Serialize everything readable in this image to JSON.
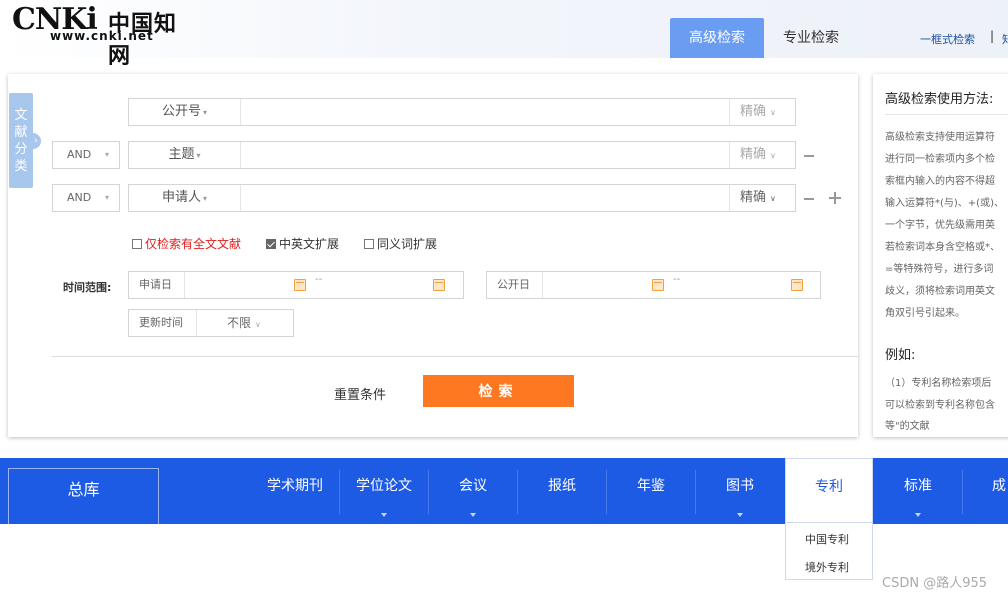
{
  "logo": {
    "mark": "CNKi",
    "name": "中国知网",
    "url": "www.cnki.net"
  },
  "header": {
    "tabs": [
      {
        "label": "高级检索"
      },
      {
        "label": "专业检索"
      }
    ],
    "links": [
      "一框式检索",
      "|",
      "知"
    ]
  },
  "sidetab": {
    "label": "文献分类",
    "chars": [
      "文",
      "献",
      "分",
      "类"
    ]
  },
  "search_rows": [
    {
      "logic": "",
      "field": "公开号",
      "precision": "精确"
    },
    {
      "logic": "AND",
      "field": "主题",
      "precision": "精确"
    },
    {
      "logic": "AND",
      "field": "申请人",
      "precision": "精确"
    }
  ],
  "options": [
    {
      "label": "仅检索有全文文献",
      "checked": false
    },
    {
      "label": "中英文扩展",
      "checked": true
    },
    {
      "label": "同义词扩展",
      "checked": false
    }
  ],
  "time": {
    "label": "时间范围:",
    "apply_date": "申请日",
    "pub_date": "公开日",
    "range_sep": "--",
    "update_label": "更新时间",
    "update_value": "不限"
  },
  "actions": {
    "reset": "重置条件",
    "search": "检索"
  },
  "help": {
    "title": "高级检索使用方法:",
    "lines": [
      "高级检索支持使用运算符",
      "进行同一检索项内多个检",
      "索框内输入的内容不得超",
      "输入运算符*(与)、+(或)、",
      "一个字节，优先级需用英",
      "若检索词本身含空格或*、",
      "=等特殊符号，进行多词",
      "歧义，须将检索词用英文",
      "角双引号引起来。"
    ],
    "example_title": "例如:",
    "example_lines": [
      "（1）专利名称检索项后",
      "可以检索到专利名称包含",
      "等\"的文献"
    ]
  },
  "nav": {
    "total": "总库",
    "items": [
      {
        "label": "学术期刊",
        "dropdown": false
      },
      {
        "label": "学位论文",
        "dropdown": true
      },
      {
        "label": "会议",
        "dropdown": true
      },
      {
        "label": "报纸",
        "dropdown": false
      },
      {
        "label": "年鉴",
        "dropdown": false
      },
      {
        "label": "图书",
        "dropdown": true
      },
      {
        "label": "专利",
        "dropdown": false,
        "active": true
      },
      {
        "label": "标准",
        "dropdown": true
      },
      {
        "label": "成",
        "dropdown": false
      }
    ],
    "patent_menu": [
      "中国专利",
      "境外专利"
    ]
  },
  "watermark": "CSDN @路人955"
}
